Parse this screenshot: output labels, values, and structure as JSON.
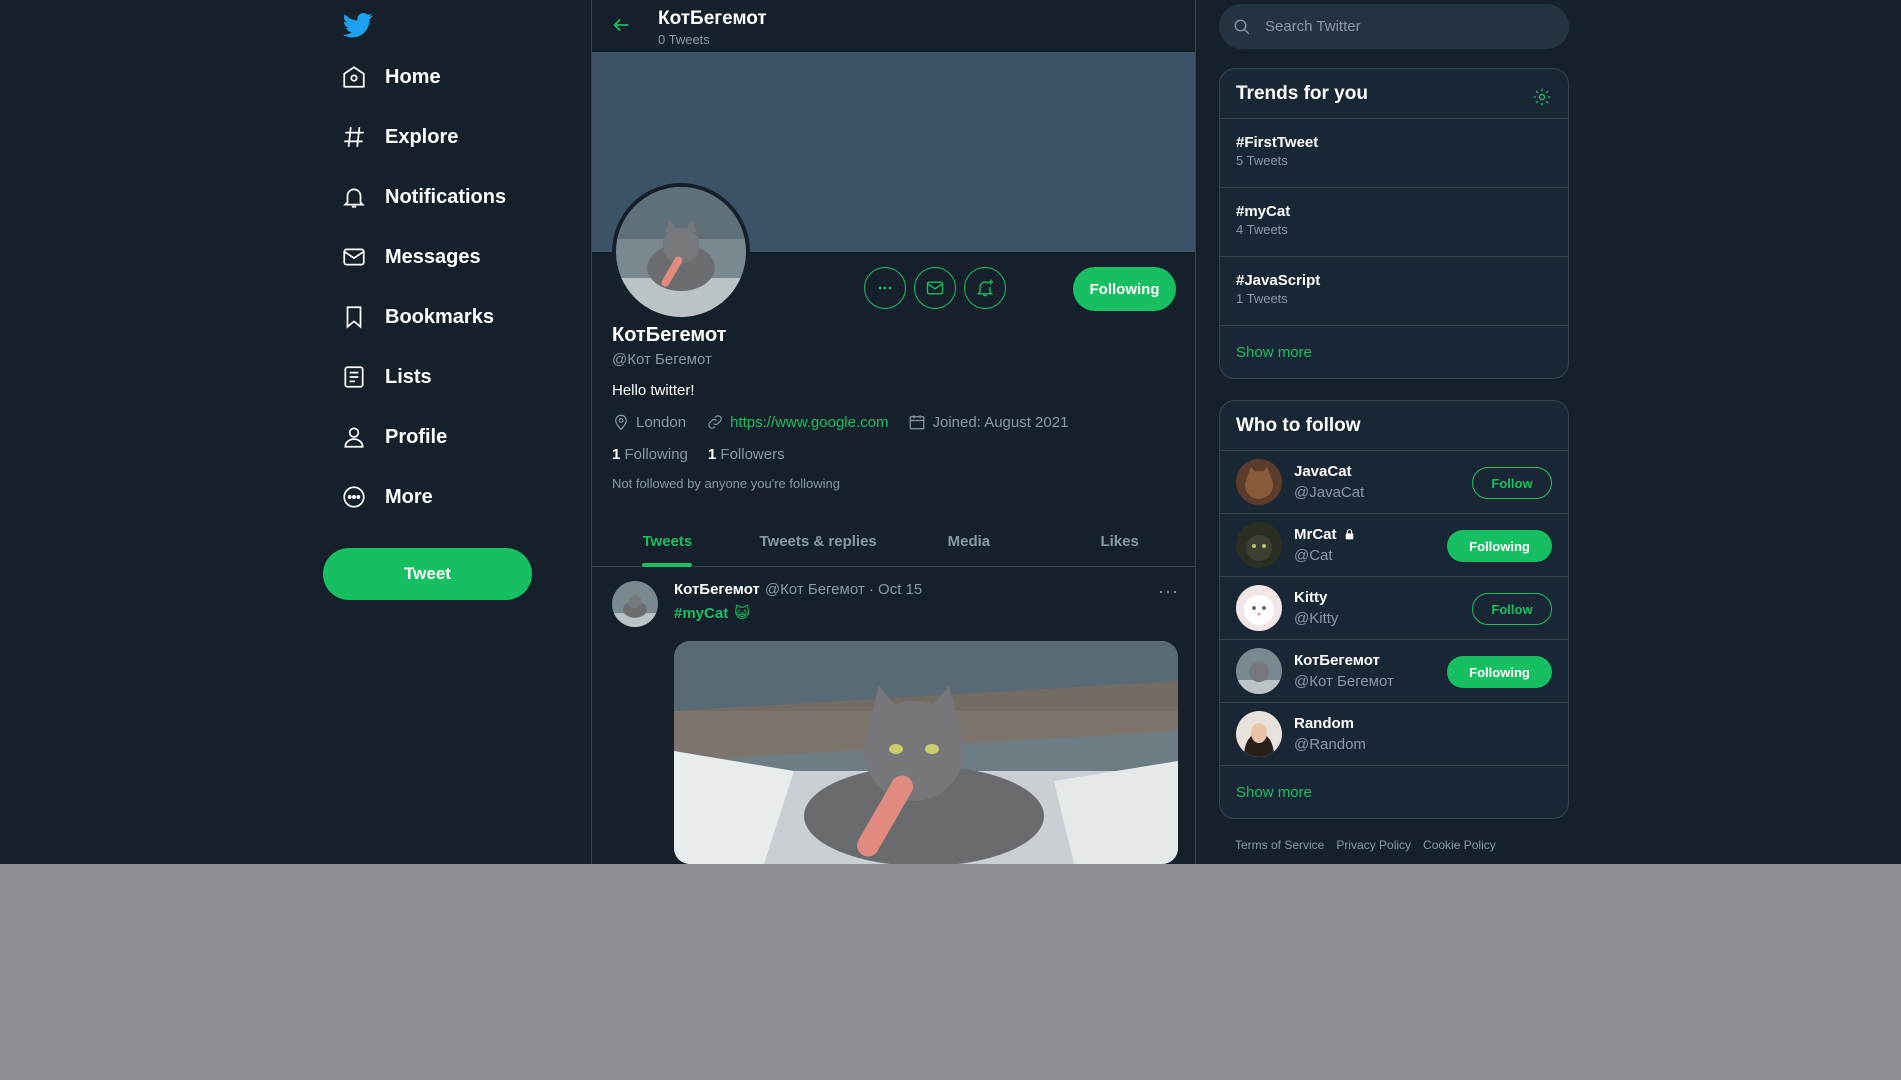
{
  "sidebar": {
    "items": [
      {
        "label": "Home",
        "icon": "home-icon"
      },
      {
        "label": "Explore",
        "icon": "hashtag-icon"
      },
      {
        "label": "Notifications",
        "icon": "bell-icon"
      },
      {
        "label": "Messages",
        "icon": "mail-icon"
      },
      {
        "label": "Bookmarks",
        "icon": "bookmark-icon"
      },
      {
        "label": "Lists",
        "icon": "list-icon"
      },
      {
        "label": "Profile",
        "icon": "user-icon"
      },
      {
        "label": "More",
        "icon": "more-circle-icon"
      }
    ],
    "tweet_button": "Tweet"
  },
  "header": {
    "title": "КотБегемот",
    "subtitle": "0 Tweets"
  },
  "profile": {
    "name": "КотБегемот",
    "handle": "@Кот Бегемот",
    "bio": "Hello twitter!",
    "location": "London",
    "website": "https://www.google.com",
    "joined": "Joined: August 2021",
    "following_count": "1",
    "following_label": "Following",
    "followers_count": "1",
    "followers_label": "Followers",
    "not_followed": "Not followed by anyone you're following",
    "following_button": "Following"
  },
  "tabs": [
    {
      "label": "Tweets",
      "active": true
    },
    {
      "label": "Tweets & replies",
      "active": false
    },
    {
      "label": "Media",
      "active": false
    },
    {
      "label": "Likes",
      "active": false
    }
  ],
  "tweet": {
    "author": "КотБегемот",
    "meta": "@Кот Бегемот · Oct 15",
    "text": "#myCat",
    "emoji": "😺",
    "more": "···"
  },
  "search": {
    "placeholder": "Search Twitter"
  },
  "trends": {
    "title": "Trends for you",
    "items": [
      {
        "tag": "#FirstTweet",
        "count": "5 Tweets"
      },
      {
        "tag": "#myCat",
        "count": "4 Tweets"
      },
      {
        "tag": "#JavaScript",
        "count": "1 Tweets"
      }
    ],
    "show_more": "Show more"
  },
  "who_to_follow": {
    "title": "Who to follow",
    "items": [
      {
        "name": "JavaCat",
        "handle": "@JavaCat",
        "button": "Follow",
        "locked": false
      },
      {
        "name": "MrCat",
        "handle": "@Cat",
        "button": "Following",
        "locked": true
      },
      {
        "name": "Kitty",
        "handle": "@Kitty",
        "button": "Follow",
        "locked": false
      },
      {
        "name": "КотБегемот",
        "handle": "@Кот Бегемот",
        "button": "Following",
        "locked": false
      },
      {
        "name": "Random",
        "handle": "@Random",
        "button": "",
        "locked": false
      }
    ],
    "show_more": "Show more"
  },
  "footer": {
    "links": [
      "Terms of Service",
      "Privacy Policy",
      "Cookie Policy"
    ]
  },
  "colors": {
    "accent": "#17bf63",
    "background": "#15202b",
    "panel": "#192734",
    "border": "#38444d",
    "muted": "#8899a6"
  }
}
